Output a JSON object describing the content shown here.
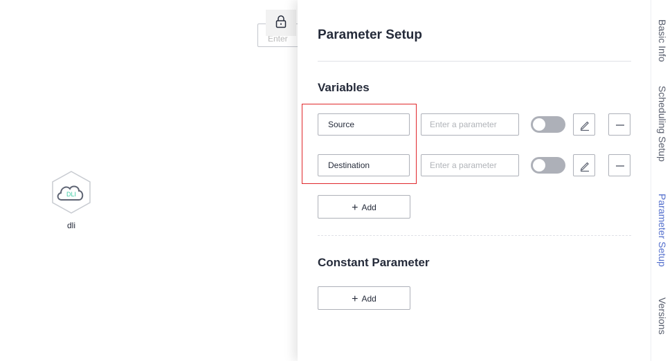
{
  "canvas": {
    "node": {
      "label": "dli",
      "icon_text": "DLI",
      "icon": "cloud-icon",
      "accent": "#3dcca6"
    },
    "search_placeholder": "Enter",
    "lock_icon": "lock-icon"
  },
  "drawer": {
    "title": "Parameter Setup",
    "variables": {
      "title": "Variables",
      "rows": [
        {
          "name": "Source",
          "value": "",
          "placeholder": "Enter a parameter",
          "enabled": false
        },
        {
          "name": "Destination",
          "value": "",
          "placeholder": "Enter a parameter",
          "enabled": false
        }
      ],
      "add_label": "Add"
    },
    "constant": {
      "title": "Constant Parameter",
      "add_label": "Add"
    }
  },
  "tabs": [
    {
      "label": "Basic Info",
      "active": false
    },
    {
      "label": "Scheduling Setup",
      "active": false
    },
    {
      "label": "Parameter Setup",
      "active": true
    },
    {
      "label": "Versions",
      "active": false
    }
  ],
  "colors": {
    "highlight": "#e0262a",
    "active_tab": "#526ecc",
    "toggle_off": "#adb0b8"
  }
}
